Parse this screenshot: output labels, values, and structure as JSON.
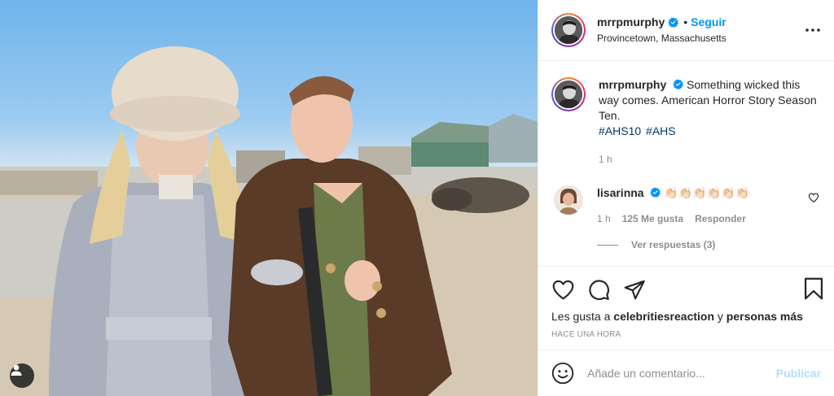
{
  "post": {
    "author": {
      "username": "mrrpmurphy",
      "verified": true,
      "follow_label": "Seguir",
      "location": "Provincetown, Massachusetts",
      "avatar_icon": "person-avatar"
    },
    "caption": {
      "text": "Something wicked this way comes. American Horror Story Season Ten.",
      "hashtags": [
        "#AHS10",
        "#AHS"
      ],
      "time": "1 h"
    },
    "comments": [
      {
        "username": "lisarinna",
        "verified": true,
        "text": "👏🏻👏🏻👏🏻👏🏻👏🏻👏🏻",
        "time": "1 h",
        "likes": "125 Me gusta",
        "reply_label": "Responder",
        "view_replies": "Ver respuestas (3)"
      }
    ],
    "likes_line": {
      "prefix": "Les gusta a",
      "user": "celebritiesreaction",
      "conj": "y",
      "others": "personas más"
    },
    "time_ago": "HACE UNA HORA",
    "add_comment": {
      "placeholder": "Añade un comentario...",
      "publish_label": "Publicar"
    }
  },
  "colors": {
    "accent": "#0095f6",
    "hashtag": "#00376b",
    "muted": "#8e8e8e",
    "publish_disabled": "#b2dffc"
  }
}
